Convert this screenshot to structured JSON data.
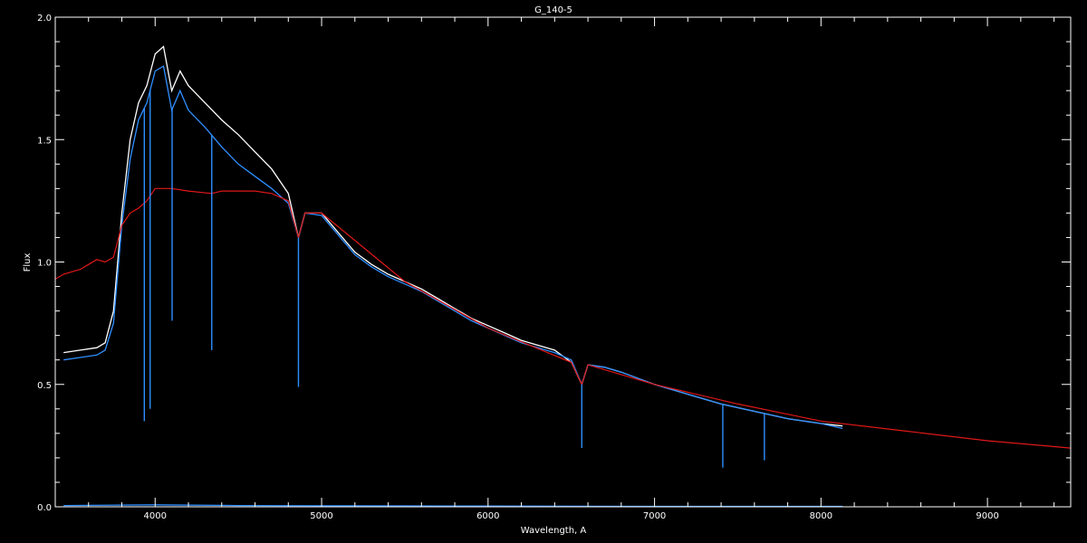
{
  "chart_data": {
    "type": "line",
    "title": "G_140-5",
    "xlabel": "Wavelength, A",
    "ylabel": "Flux",
    "xlim": [
      3400,
      9500
    ],
    "ylim": [
      0.0,
      2.0
    ],
    "x_ticks": [
      4000,
      5000,
      6000,
      7000,
      8000,
      9000
    ],
    "x_tick_labels": [
      "4000",
      "5000",
      "6000",
      "7000",
      "8000",
      "9000"
    ],
    "y_ticks": [
      0.0,
      0.5,
      1.0,
      1.5,
      2.0
    ],
    "y_tick_labels": [
      "0.0",
      "0.5",
      "1.0",
      "1.5",
      "2.0"
    ],
    "grid": false,
    "background": "#000000",
    "colors": {
      "axis": "#ffffff",
      "observed": "#ffffff",
      "calibrated": "#2f8fff",
      "model": "#e01818",
      "error": "#2f8fff"
    },
    "series": [
      {
        "key": "observed",
        "color": "#ffffff",
        "x": [
          3450,
          3550,
          3650,
          3700,
          3750,
          3800,
          3850,
          3900,
          3950,
          4000,
          4050,
          4100,
          4150,
          4200,
          4300,
          4400,
          4500,
          4600,
          4700,
          4800,
          4861,
          4900,
          5000,
          5100,
          5200,
          5300,
          5400,
          5500,
          5600,
          5700,
          5800,
          5900,
          6000,
          6100,
          6200,
          6300,
          6400,
          6500,
          6563,
          6600,
          6700,
          6800,
          7000,
          7200,
          7400,
          7600,
          7800,
          8000,
          8130
        ],
        "y": [
          0.63,
          0.64,
          0.65,
          0.67,
          0.8,
          1.2,
          1.5,
          1.65,
          1.72,
          1.85,
          1.88,
          1.7,
          1.78,
          1.72,
          1.65,
          1.58,
          1.52,
          1.45,
          1.38,
          1.28,
          1.1,
          1.2,
          1.2,
          1.12,
          1.04,
          0.99,
          0.95,
          0.92,
          0.89,
          0.85,
          0.81,
          0.77,
          0.74,
          0.71,
          0.68,
          0.66,
          0.64,
          0.59,
          0.5,
          0.58,
          0.57,
          0.55,
          0.5,
          0.46,
          0.42,
          0.39,
          0.36,
          0.34,
          0.33
        ]
      },
      {
        "key": "calibrated",
        "color": "#2f8fff",
        "x": [
          3450,
          3550,
          3650,
          3700,
          3750,
          3800,
          3850,
          3900,
          3950,
          4000,
          4050,
          4100,
          4150,
          4200,
          4300,
          4400,
          4500,
          4600,
          4700,
          4800,
          4861,
          4900,
          5000,
          5100,
          5200,
          5300,
          5400,
          5500,
          5600,
          5700,
          5800,
          5900,
          6000,
          6100,
          6200,
          6300,
          6400,
          6500,
          6563,
          6600,
          6700,
          6800,
          7000,
          7200,
          7400,
          7600,
          7800,
          8000,
          8130
        ],
        "y": [
          0.6,
          0.61,
          0.62,
          0.64,
          0.75,
          1.15,
          1.42,
          1.58,
          1.65,
          1.78,
          1.8,
          1.62,
          1.7,
          1.62,
          1.55,
          1.47,
          1.4,
          1.35,
          1.3,
          1.24,
          1.1,
          1.2,
          1.19,
          1.11,
          1.03,
          0.98,
          0.94,
          0.91,
          0.88,
          0.84,
          0.8,
          0.76,
          0.73,
          0.7,
          0.67,
          0.65,
          0.63,
          0.6,
          0.5,
          0.58,
          0.57,
          0.55,
          0.5,
          0.46,
          0.42,
          0.39,
          0.36,
          0.34,
          0.32
        ]
      },
      {
        "key": "model",
        "color": "#e01818",
        "x": [
          3400,
          3450,
          3500,
          3550,
          3600,
          3650,
          3700,
          3750,
          3800,
          3850,
          3900,
          3950,
          4000,
          4100,
          4200,
          4340,
          4400,
          4500,
          4600,
          4700,
          4800,
          4861,
          4900,
          5000,
          5500,
          6000,
          6500,
          6563,
          6600,
          7000,
          7500,
          8000,
          8500,
          9000,
          9500
        ],
        "y": [
          0.93,
          0.95,
          0.96,
          0.97,
          0.99,
          1.01,
          1.0,
          1.02,
          1.15,
          1.2,
          1.22,
          1.25,
          1.3,
          1.3,
          1.29,
          1.28,
          1.29,
          1.29,
          1.29,
          1.28,
          1.25,
          1.1,
          1.2,
          1.2,
          0.92,
          0.73,
          0.59,
          0.5,
          0.58,
          0.5,
          0.42,
          0.35,
          0.31,
          0.27,
          0.24
        ]
      },
      {
        "key": "error",
        "color": "#2f8fff",
        "x": [
          3450,
          4000,
          4500,
          5000,
          6000,
          7000,
          8130
        ],
        "y": [
          0.005,
          0.008,
          0.005,
          0.004,
          0.003,
          0.002,
          0.002
        ]
      }
    ],
    "absorption_lines": [
      {
        "x": 3935,
        "y": 0.35
      },
      {
        "x": 3970,
        "y": 0.4
      },
      {
        "x": 4102,
        "y": 0.76
      },
      {
        "x": 4340,
        "y": 0.64
      },
      {
        "x": 4861,
        "y": 0.49
      },
      {
        "x": 6563,
        "y": 0.24
      },
      {
        "x": 7410,
        "y": 0.16
      },
      {
        "x": 7660,
        "y": 0.19
      }
    ]
  }
}
